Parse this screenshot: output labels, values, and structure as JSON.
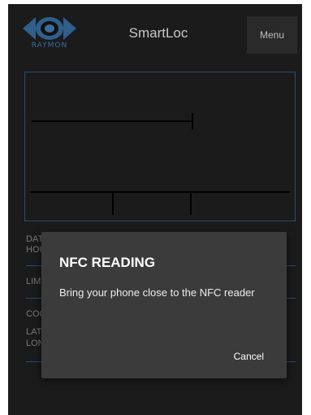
{
  "app": {
    "title": "SmartLoc",
    "menu_label": "Menu",
    "logo_text": "RAYMON",
    "accent_color": "#3a6d9a"
  },
  "form": {
    "rows": [
      {
        "label": "DAT"
      },
      {
        "label": "HOU"
      },
      {
        "label": "LIM"
      },
      {
        "label": "COO"
      },
      {
        "label": "LAT"
      },
      {
        "label": "LON"
      }
    ]
  },
  "dialog": {
    "title": "NFC READING",
    "message": "Bring your phone close to the NFC reader",
    "cancel_label": "Cancel"
  }
}
